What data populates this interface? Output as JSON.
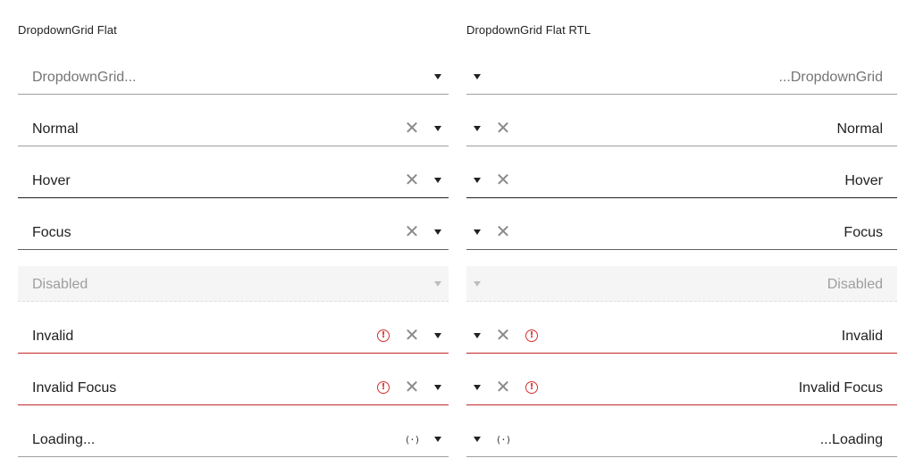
{
  "left_column": {
    "title": "DropdownGrid Flat",
    "fields": [
      {
        "state": "placeholder",
        "text": "DropdownGrid..."
      },
      {
        "state": "normal",
        "text": "Normal"
      },
      {
        "state": "hover",
        "text": "Hover"
      },
      {
        "state": "focus",
        "text": "Focus"
      },
      {
        "state": "disabled",
        "text": "Disabled"
      },
      {
        "state": "invalid",
        "text": "Invalid"
      },
      {
        "state": "invalid-focus",
        "text": "Invalid Focus"
      },
      {
        "state": "loading",
        "text": "Loading..."
      }
    ]
  },
  "right_column": {
    "title": "DropdownGrid Flat RTL",
    "fields": [
      {
        "state": "placeholder",
        "text": "...DropdownGrid"
      },
      {
        "state": "normal",
        "text": "Normal"
      },
      {
        "state": "hover",
        "text": "Hover"
      },
      {
        "state": "focus",
        "text": "Focus"
      },
      {
        "state": "disabled",
        "text": "Disabled"
      },
      {
        "state": "invalid",
        "text": "Invalid"
      },
      {
        "state": "invalid-focus",
        "text": "Invalid Focus"
      },
      {
        "state": "loading",
        "text": "...Loading"
      }
    ]
  },
  "icons": {
    "clear": "close-icon",
    "dropdown": "caret-down-icon",
    "error": "error-circle-icon",
    "loading": "loading-spinner-icon"
  },
  "glyphs": {
    "clear": "✕",
    "error": "!",
    "loading": "(·)"
  },
  "colors": {
    "text": "#212121",
    "placeholder": "#757575",
    "underline": "#9e9e9e",
    "invalid": "#c62828",
    "disabled_bg": "#f5f5f5"
  }
}
